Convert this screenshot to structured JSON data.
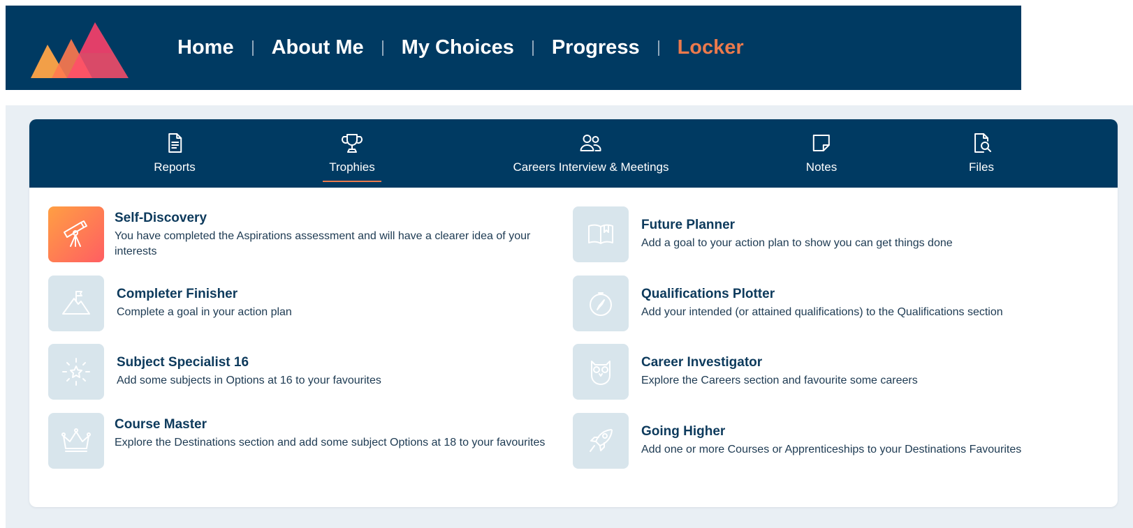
{
  "nav": {
    "items": [
      {
        "label": "Home",
        "active": false
      },
      {
        "label": "About Me",
        "active": false
      },
      {
        "label": "My Choices",
        "active": false
      },
      {
        "label": "Progress",
        "active": false
      },
      {
        "label": "Locker",
        "active": true
      }
    ]
  },
  "tabs": [
    {
      "label": "Reports",
      "icon": "document-icon",
      "active": false
    },
    {
      "label": "Trophies",
      "icon": "trophy-icon",
      "active": true
    },
    {
      "label": "Careers Interview & Meetings",
      "icon": "users-icon",
      "active": false
    },
    {
      "label": "Notes",
      "icon": "note-icon",
      "active": false
    },
    {
      "label": "Files",
      "icon": "file-search-icon",
      "active": false
    }
  ],
  "trophies": [
    {
      "title": "Self-Discovery",
      "description": "You have completed the Aspirations assessment and will have a clearer idea of your interests",
      "icon": "telescope-icon",
      "earned": true
    },
    {
      "title": "Future Planner",
      "description": "Add a goal to your action plan to show you can get things done",
      "icon": "book-icon",
      "earned": false
    },
    {
      "title": "Completer Finisher",
      "description": "Complete a goal in your action plan",
      "icon": "mountain-flag-icon",
      "earned": false
    },
    {
      "title": "Qualifications Plotter",
      "description": "Add your intended (or attained qualifications) to the Qualifications section",
      "icon": "compass-icon",
      "earned": false
    },
    {
      "title": "Subject Specialist 16",
      "description": "Add some subjects in Options at 16 to your favourites",
      "icon": "star-burst-icon",
      "earned": false
    },
    {
      "title": "Career Investigator",
      "description": "Explore the Careers section and favourite some careers",
      "icon": "owl-icon",
      "earned": false
    },
    {
      "title": "Course Master",
      "description": "Explore the Destinations section and add some subject Options at 18 to your favourites",
      "icon": "crown-icon",
      "earned": false
    },
    {
      "title": "Going Higher",
      "description": "Add one or more Courses or Apprenticeships to your Destinations Favourites",
      "icon": "rocket-icon",
      "earned": false
    }
  ],
  "colors": {
    "header_bg": "#003a62",
    "active_accent": "#ec7a4c",
    "locked_tile": "#d8e5ec",
    "earned_gradient_start": "#ff9f43",
    "earned_gradient_end": "#ff5e62"
  }
}
